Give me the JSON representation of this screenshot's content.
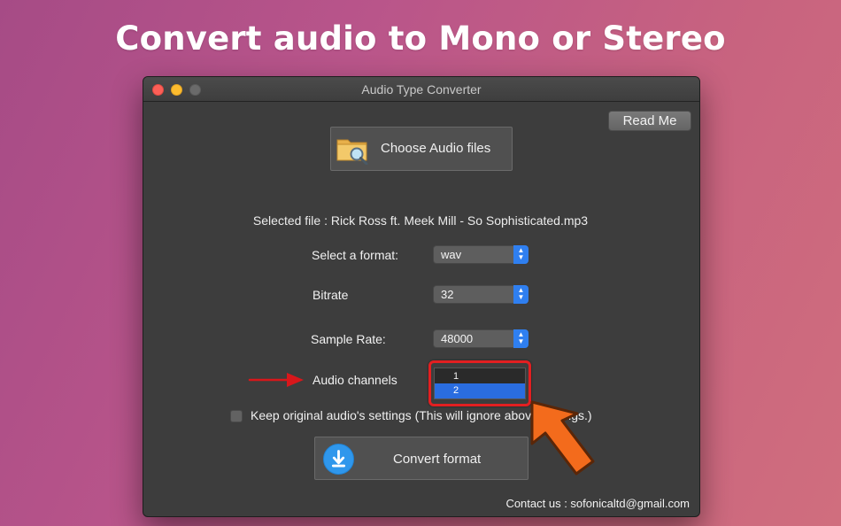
{
  "headline": "Convert audio to Mono or Stereo",
  "window": {
    "title": "Audio Type Converter",
    "read_me_label": "Read Me",
    "choose_label": "Choose Audio files",
    "selected_file_text": "Selected file : Rick Ross ft. Meek Mill - So Sophisticated.mp3",
    "format": {
      "label": "Select a format:",
      "value": "wav"
    },
    "bitrate": {
      "label": "Bitrate",
      "value": "32"
    },
    "sample_rate": {
      "label": "Sample Rate:",
      "value": "48000"
    },
    "audio_channels": {
      "label": "Audio channels",
      "options": [
        "1",
        "2"
      ],
      "selected": "2"
    },
    "keep_settings_label": "Keep original audio's settings (This will ignore above settings.)",
    "keep_settings_checked": false,
    "convert_label": "Convert format",
    "contact_text": "Contact us : sofonicaltd@gmail.com"
  },
  "colors": {
    "highlight_border": "#e31f21",
    "arrow_red": "#d8171b",
    "arrow_orange": "#f36b1c",
    "accent_blue": "#2f7ff0"
  },
  "icons": [
    "folder-search-icon",
    "download-icon",
    "chevron-updown-icon"
  ]
}
